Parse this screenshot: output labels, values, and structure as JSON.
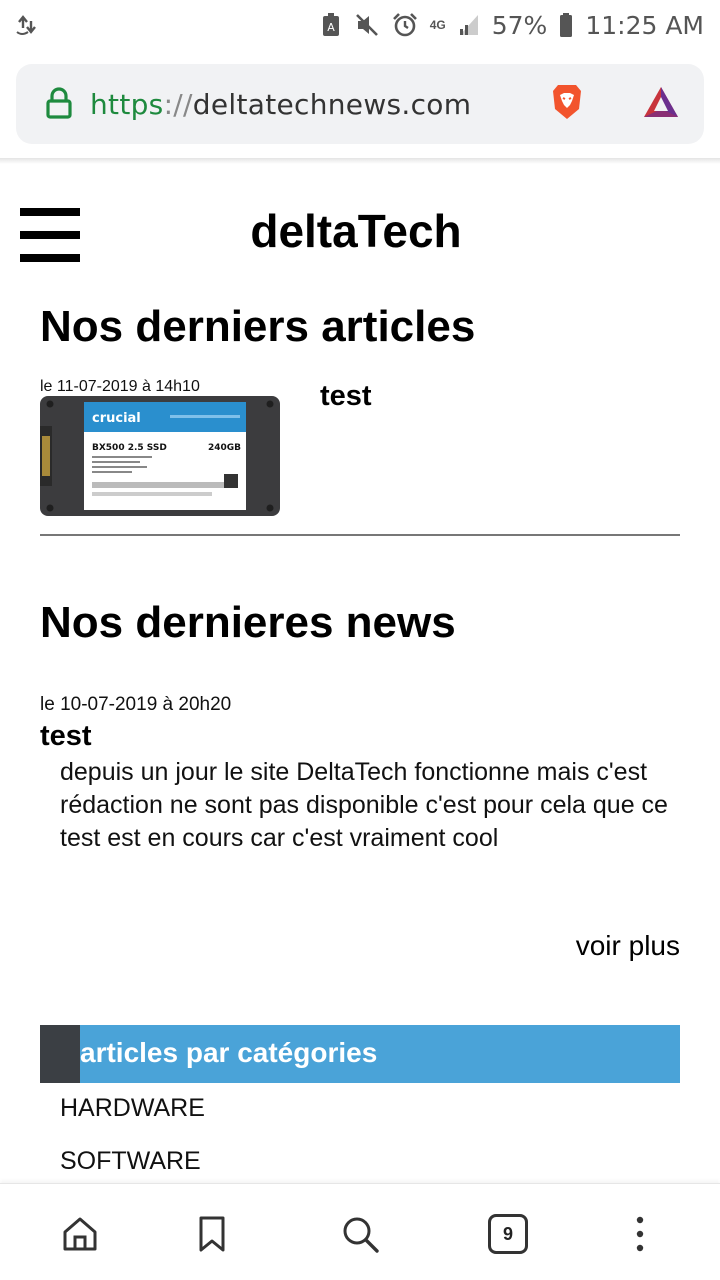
{
  "status_bar": {
    "network": "4G",
    "battery": "57%",
    "time": "11:25 AM",
    "icons": [
      "data-transfer-icon",
      "battery-saver-icon",
      "mute-icon",
      "alarm-icon",
      "signal-icon",
      "battery-icon"
    ]
  },
  "browser": {
    "url_scheme": "https",
    "url_sep": "://",
    "url_host": "deltatechnews.com",
    "icons": [
      "lock-icon",
      "brave-shields-icon",
      "brave-rewards-icon"
    ],
    "tab_count": "9"
  },
  "header": {
    "title": "deltaTech"
  },
  "articles": {
    "heading": "Nos derniers articles",
    "items": [
      {
        "date": "le 11-07-2019 à 14h10",
        "title": "test",
        "thumbnail": {
          "brand": "crucial",
          "model": "BX500 2.5 SSD",
          "capacity": "240GB"
        }
      }
    ]
  },
  "news": {
    "heading": "Nos dernieres news",
    "items": [
      {
        "date": "le 10-07-2019 à 20h20",
        "title": "test",
        "body": "depuis un jour le site DeltaTech fonctionne mais c'est rédaction ne sont pas disponible c'est pour cela que ce test est en cours car c'est vraiment cool"
      }
    ],
    "more_label": "voir plus"
  },
  "categories": {
    "heading": "articles par catégories",
    "items": [
      "HARDWARE",
      "SOFTWARE"
    ]
  },
  "colors": {
    "category_bar": "#4aa3d8",
    "category_bar_dark": "#3b3f44",
    "url_scheme": "#1e8a3e"
  },
  "bottom_nav": [
    "home-icon",
    "bookmark-icon",
    "search-icon",
    "tabs-icon",
    "more-icon"
  ]
}
